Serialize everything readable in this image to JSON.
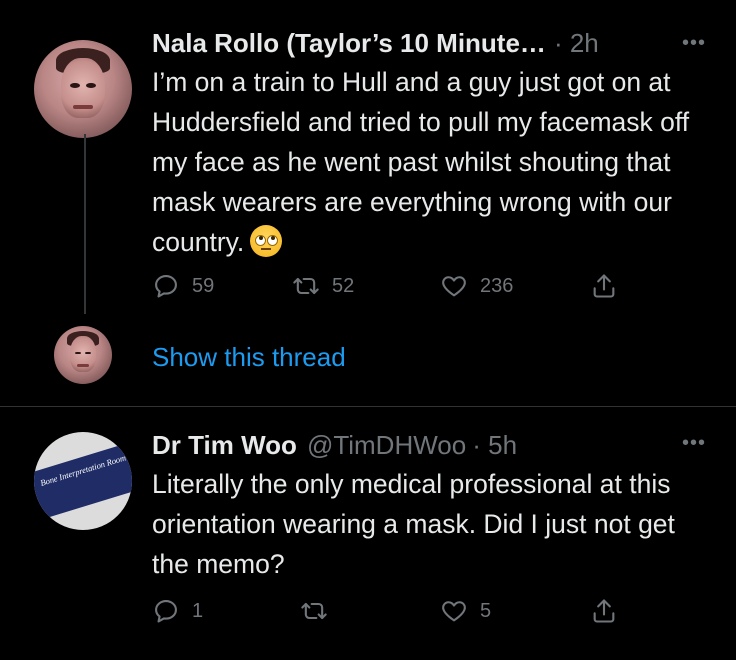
{
  "tweet1": {
    "author_name": "Nala Rollo (Taylor’s 10 Minute…",
    "time": "· 2h",
    "text": "I’m on a train to Hull and a guy just got on at Huddersfield and tried to pull my facemask off my face as he went past whilst shouting that mask wearers are everything wrong with our country.",
    "emoji_icon": "face-with-rolling-eyes",
    "replies": "59",
    "retweets": "52",
    "likes": "236"
  },
  "thread_link": "Show this thread",
  "tweet2": {
    "author_name": "Dr Tim Woo",
    "handle": "@TimDHWoo",
    "time": "· 5h",
    "text": "Literally the only medical professional at this orientation wearing a mask. Did I just not get the memo?",
    "avatar_sign_text": "Bone Interpretation Room",
    "replies": "1",
    "retweets": "",
    "likes": "5"
  },
  "colors": {
    "background": "#000000",
    "text": "#e7e9ea",
    "secondary": "#71767b",
    "link": "#1d9bf0",
    "divider": "#2f3336"
  }
}
